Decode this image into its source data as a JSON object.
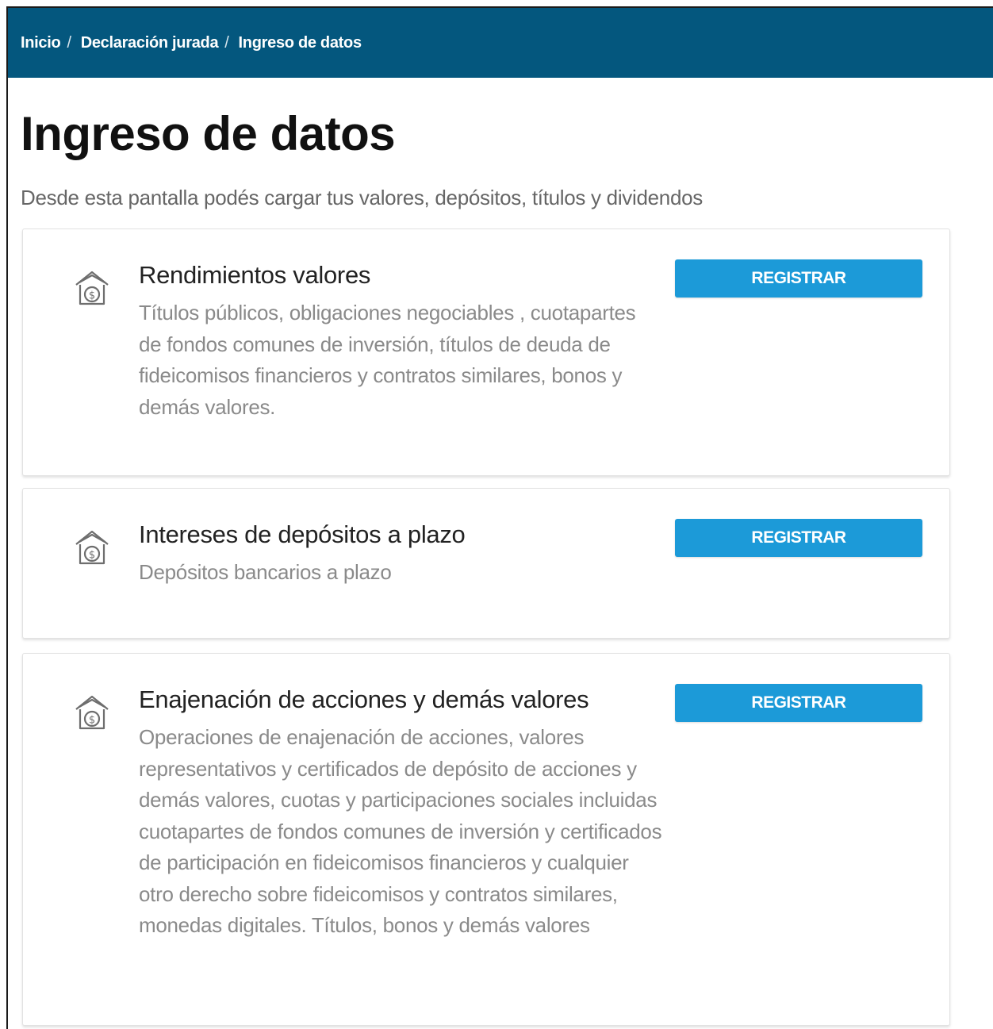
{
  "breadcrumb": {
    "items": [
      "Inicio",
      "Declaración jurada",
      "Ingreso de datos"
    ],
    "separator": "/"
  },
  "page": {
    "title": "Ingreso de datos",
    "subtitle": "Desde esta pantalla podés cargar tus valores, depósitos, títulos y dividendos"
  },
  "cards": [
    {
      "icon": "money-house-icon",
      "title": "Rendimientos valores",
      "description": "Títulos públicos, obligaciones negociables , cuotapartes de fondos comunes de inversión, títulos de deuda de fideicomisos financieros y contratos similares, bonos y demás valores.",
      "button_label": "REGISTRAR"
    },
    {
      "icon": "money-house-icon",
      "title": "Intereses de depósitos a plazo",
      "description": "Depósitos bancarios a plazo",
      "button_label": "REGISTRAR"
    },
    {
      "icon": "money-house-icon",
      "title": "Enajenación de acciones y demás valores",
      "description": "Operaciones de enajenación de acciones, valores representativos y certificados de depósito de acciones y demás valores, cuotas y participaciones sociales incluidas cuotapartes de fondos comunes de inversión y certificados de participación en fideicomisos financieros y cualquier otro derecho sobre fideicomisos y contratos similares, monedas digitales. Títulos, bonos y demás valores",
      "button_label": "REGISTRAR"
    }
  ],
  "colors": {
    "header_bg": "#04577e",
    "button_bg": "#1c9ad8",
    "title_text": "#111111",
    "muted_text": "#8a8a8a"
  }
}
